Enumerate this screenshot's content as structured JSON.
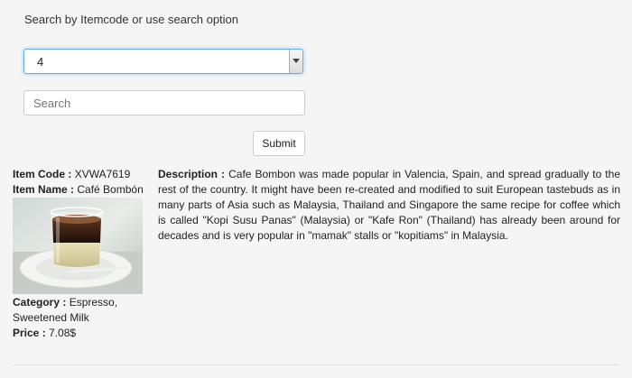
{
  "search_hint": "Search by Itemcode or use search option",
  "select": {
    "value": "4"
  },
  "search": {
    "placeholder": "Search",
    "value": ""
  },
  "submit_label": "Submit",
  "item": {
    "code_label": "Item Code :",
    "code_value": "XVWA7619",
    "name_label": "Item Name :",
    "name_value": "Café Bombón",
    "category_label": "Category :",
    "category_value": "Espresso, Sweetened Milk",
    "price_label": "Price :",
    "price_value": "7.08$",
    "description_label": "Description :",
    "description_text": "Cafe Bombon was made popular in Valencia, Spain, and spread gradually to the rest of the country. It might have been re-created and modified to suit European tastebuds as in many parts of Asia such as Malaysia, Thailand and Singapore the same recipe for coffee which is called \"Kopi Susu Panas\" (Malaysia) or \"Kafe Ron\" (Thailand) has already been around for decades and is very popular in \"mamak\" stalls or \"kopitiams\" in Malaysia."
  }
}
